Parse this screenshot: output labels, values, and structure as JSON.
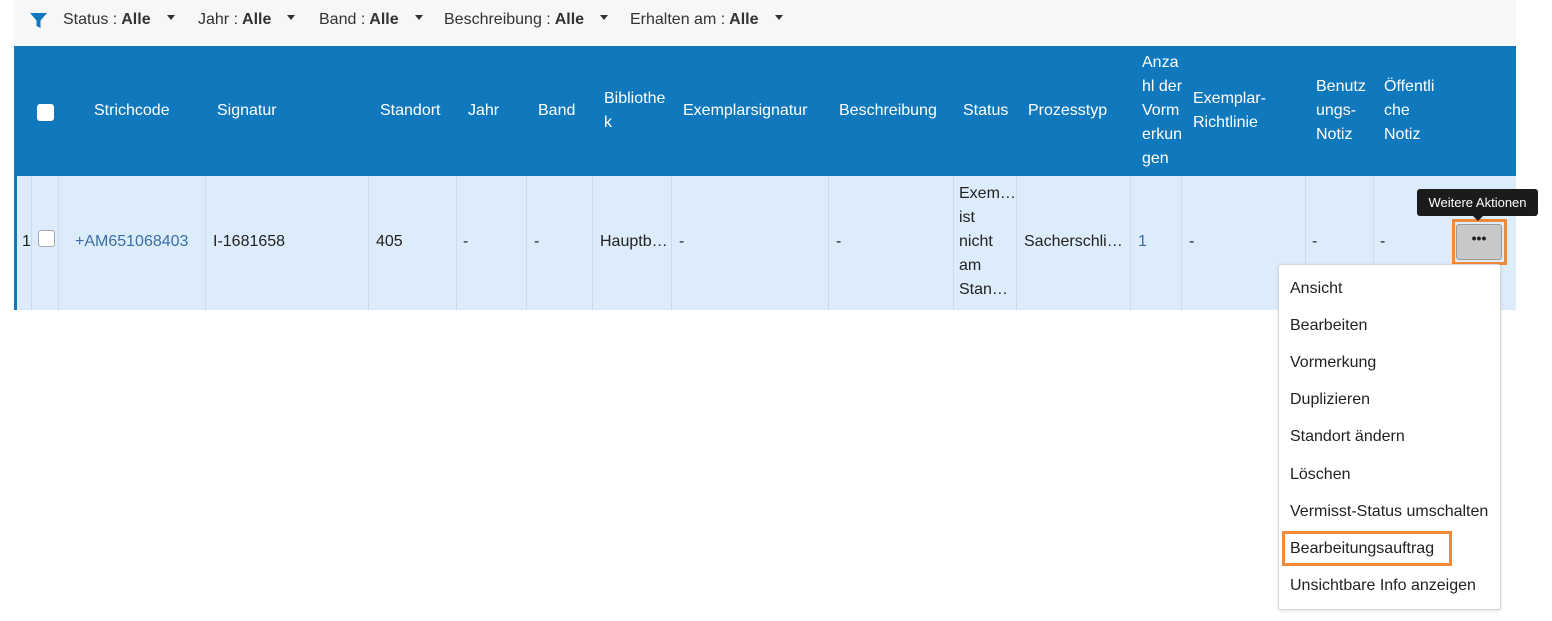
{
  "filters": [
    {
      "label": "Status :",
      "value": "Alle"
    },
    {
      "label": "Jahr :",
      "value": "Alle"
    },
    {
      "label": "Band :",
      "value": "Alle"
    },
    {
      "label": "Beschreibung :",
      "value": "Alle"
    },
    {
      "label": "Erhalten am :",
      "value": "Alle"
    }
  ],
  "table": {
    "headers": {
      "barcode": "Strichcode",
      "signature": "Signatur",
      "location": "Standort",
      "year": "Jahr",
      "band": "Band",
      "library_l1": "Bibliothe",
      "library_l2": "k",
      "item_signature": "Exemplarsignatur",
      "description": "Beschreibung",
      "status": "Status",
      "process_type": "Prozesstyp",
      "requests_l1": "Anza",
      "requests_l2": "hl der",
      "requests_l3": "Vorm",
      "requests_l4": "erkun",
      "requests_l5": "gen",
      "policy_l1": "Exemplar-",
      "policy_l2": "Richtlinie",
      "user_note_l1": "Benutz",
      "user_note_l2": "ungs-",
      "user_note_l3": "Notiz",
      "public_note_l1": "Öffentli",
      "public_note_l2": "che",
      "public_note_l3": "Notiz"
    },
    "row": {
      "index": "1",
      "barcode": "+AM651068403",
      "signature": "I-1681658",
      "location": "405",
      "year": "-",
      "band": "-",
      "library": "Hauptb…",
      "item_signature": "-",
      "description": "-",
      "status_l1": "Exem…",
      "status_l2": "ist",
      "status_l3": "nicht",
      "status_l4": "am",
      "status_l5": "Stan…",
      "process_type": "Sacherschli…",
      "requests": "1",
      "policy": "-",
      "user_note": "-",
      "public_note": "-"
    }
  },
  "more_button": {
    "label": "•••"
  },
  "tooltip": "Weitere Aktionen",
  "menu": [
    "Ansicht",
    "Bearbeiten",
    "Vormerkung",
    "Duplizieren",
    "Standort ändern",
    "Löschen",
    "Vermisst-Status umschalten",
    "Bearbeitungsauftrag",
    "Unsichtbare Info anzeigen"
  ],
  "colors": {
    "header_blue": "#1079bd",
    "row_bg": "#dcecfb",
    "highlight_orange": "#ef8a3a",
    "link_blue": "#3a6ea5"
  }
}
